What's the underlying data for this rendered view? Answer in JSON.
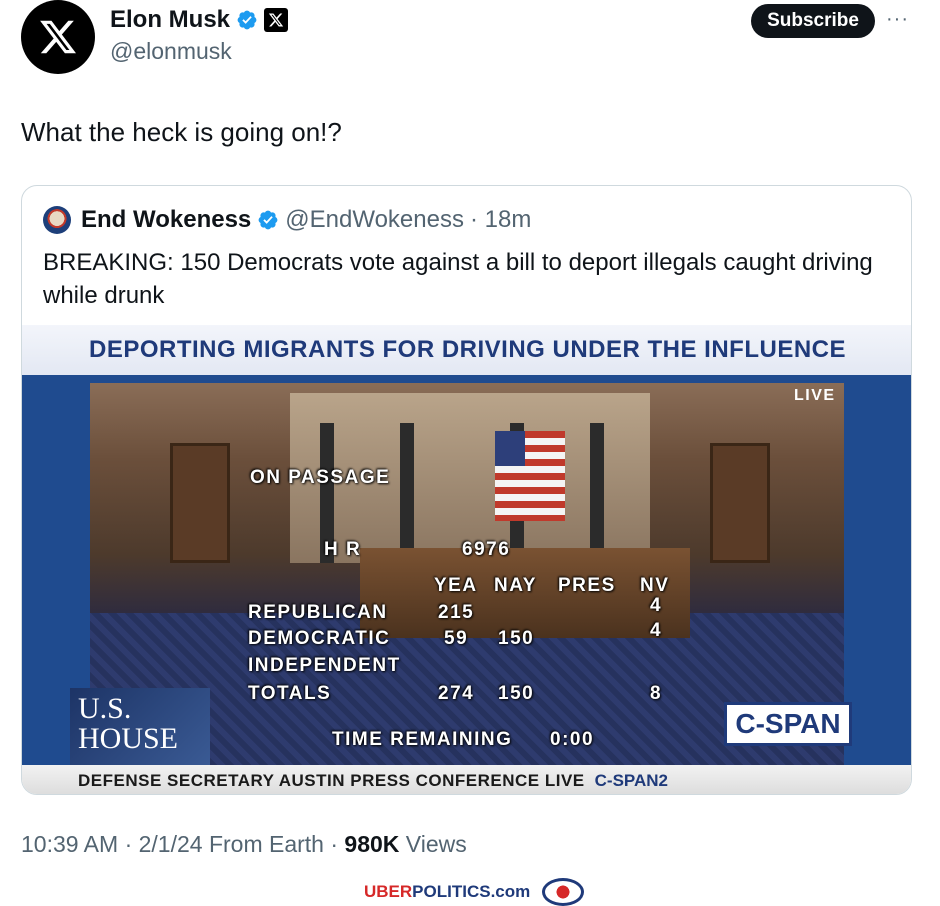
{
  "author": {
    "name": "Elon Musk",
    "handle": "@elonmusk",
    "avatar_icon": "x-logo-icon",
    "verified_icon": "verified-badge-icon",
    "affiliate_icon": "x-affiliate-badge-icon"
  },
  "actions": {
    "subscribe_label": "Subscribe",
    "more_label": "···"
  },
  "tweet": {
    "text": "What the heck is going on!?"
  },
  "quote": {
    "name": "End Wokeness",
    "handle": "@EndWokeness",
    "time": "· 18m",
    "text": "BREAKING: 150 Democrats vote against a bill to deport illegals caught driving while drunk",
    "media": {
      "headline": "DEPORTING MIGRANTS FOR DRIVING UNDER THE INFLUENCE",
      "live": "LIVE",
      "on_passage": "ON PASSAGE",
      "bill_prefix": "H R",
      "bill_number": "6976",
      "col_yea": "YEA",
      "col_nay": "NAY",
      "col_pres": "PRES",
      "col_nv": "NV",
      "rows": [
        {
          "label": "REPUBLICAN",
          "yea": "215",
          "nay": "",
          "nv": "4"
        },
        {
          "label": "DEMOCRATIC",
          "yea": "59",
          "nay": "150",
          "nv": "4"
        },
        {
          "label": "INDEPENDENT",
          "yea": "",
          "nay": "",
          "nv": ""
        },
        {
          "label": "TOTALS",
          "yea": "274",
          "nay": "150",
          "nv": "8"
        }
      ],
      "time_remaining_label": "TIME REMAINING",
      "time_remaining_value": "0:00",
      "us_house_line1": "U.S.",
      "us_house_line2": "HOUSE",
      "network_logo": "C-SPAN",
      "ticker": "DEFENSE SECRETARY AUSTIN PRESS CONFERENCE  LIVE",
      "ticker_network": "C-SPAN2"
    }
  },
  "meta": {
    "time": "10:39 AM · 2/1/24 From Earth · ",
    "views_count": "980K",
    "views_label": " Views"
  },
  "watermark": {
    "prefix": "UBER",
    "suffix": "POLITICS.com"
  },
  "colors": {
    "text": "#0f1419",
    "muted": "#536471",
    "verified": "#1d9bf0",
    "border": "#cfd9de"
  }
}
